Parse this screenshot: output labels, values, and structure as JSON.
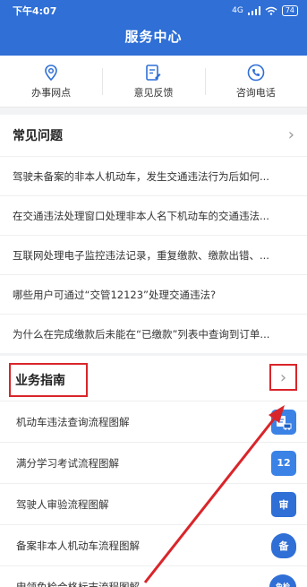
{
  "status_bar": {
    "time": "下午4:07",
    "network": "4G",
    "battery": "74"
  },
  "header": {
    "title": "服务中心"
  },
  "services": [
    {
      "label": "办事网点",
      "icon": "location-pin-icon"
    },
    {
      "label": "意见反馈",
      "icon": "feedback-edit-icon"
    },
    {
      "label": "咨询电话",
      "icon": "phone-icon"
    }
  ],
  "faq": {
    "title": "常见问题",
    "items": [
      "驾驶未备案的非本人机动车，发生交通违法行为后如何...",
      "在交通违法处理窗口处理非本人名下机动车的交通违法...",
      "互联网处理电子监控违法记录，重复缴款、缴款出错、...",
      "哪些用户可通过“交管12123”处理交通违法?",
      "为什么在完成缴款后未能在“已缴款”列表中查询到订单..."
    ]
  },
  "guide": {
    "title": "业务指南",
    "items": [
      {
        "label": "机动车违法查询流程图解",
        "icon": "vehicle-violation-icon",
        "badge": ""
      },
      {
        "label": "满分学习考试流程图解",
        "icon": "calendar-12-icon",
        "badge": "12"
      },
      {
        "label": "驾驶人审验流程图解",
        "icon": "driver-review-icon",
        "badge": "审"
      },
      {
        "label": "备案非本人机动车流程图解",
        "icon": "record-shield-icon",
        "badge": "备"
      },
      {
        "label": "申领免检合格标志流程图解",
        "icon": "exempt-badge-icon",
        "badge": "免检"
      }
    ]
  },
  "colors": {
    "header_bg": "#2f6fd6",
    "accent_blue": "#2f6fd6",
    "highlight_red": "#d9252a"
  }
}
